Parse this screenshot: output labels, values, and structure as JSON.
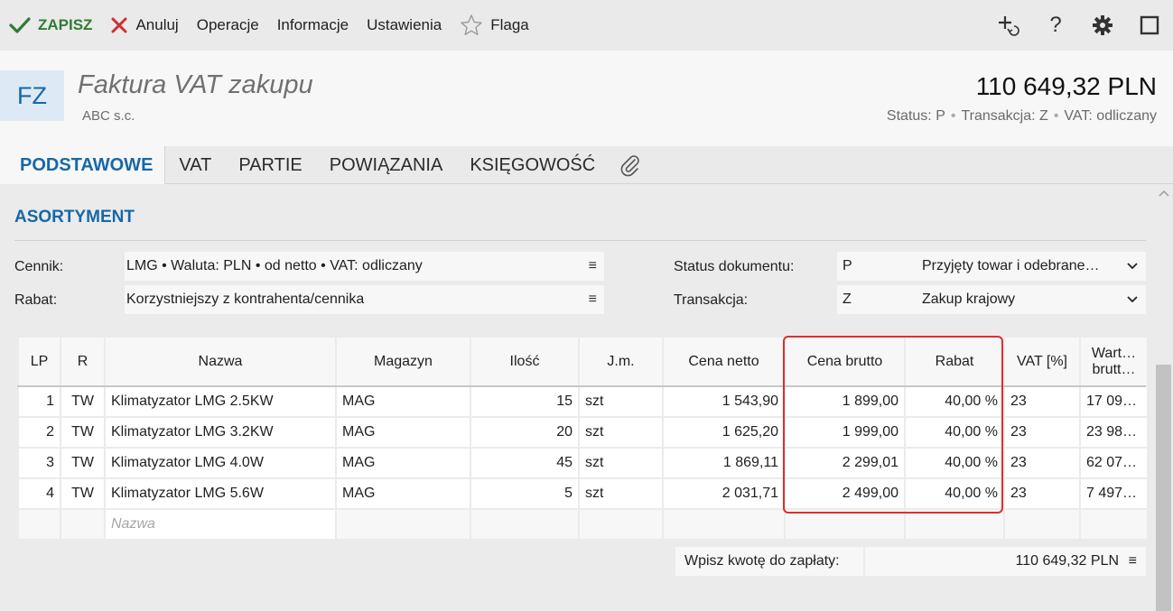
{
  "toolbar": {
    "save": "ZAPISZ",
    "cancel": "Anuluj",
    "operations": "Operacje",
    "information": "Informacje",
    "settings": "Ustawienia",
    "flag": "Flaga",
    "help": "?"
  },
  "header": {
    "badge": "FZ",
    "title": "Faktura VAT zakupu",
    "subtitle": "ABC s.c.",
    "amount": "110 649,32 PLN",
    "status_label": "Status:",
    "status_value": "P",
    "transaction_label": "Transakcja:",
    "transaction_value": "Z",
    "vat_label": "VAT:",
    "vat_value": "odliczany"
  },
  "tabs": [
    "PODSTAWOWE",
    "VAT",
    "PARTIE",
    "POWIĄZANIA",
    "KSIĘGOWOŚĆ"
  ],
  "section": {
    "title": "ASORTYMENT"
  },
  "form": {
    "pricelist_label": "Cennik:",
    "pricelist_value": "LMG • Waluta: PLN • od netto • VAT: odliczany",
    "discount_label": "Rabat:",
    "discount_value": "Korzystniejszy z kontrahenta/cennika",
    "doc_status_label": "Status dokumentu:",
    "doc_status_code": "P",
    "doc_status_value": "Przyjęty towar i odebrane…",
    "transaction_label": "Transakcja:",
    "transaction_code": "Z",
    "transaction_value": "Zakup krajowy",
    "menu_glyph": "≡"
  },
  "table": {
    "headers": {
      "lp": "LP",
      "r": "R",
      "name": "Nazwa",
      "warehouse": "Magazyn",
      "qty": "Ilość",
      "unit": "J.m.",
      "net": "Cena netto",
      "gross": "Cena brutto",
      "discount": "Rabat",
      "vat": "VAT [%]",
      "value_1": "Wart…",
      "value_2": "brutt…"
    },
    "rows": [
      {
        "lp": "1",
        "r": "TW",
        "name": "Klimatyzator LMG 2.5KW",
        "warehouse": "MAG",
        "qty": "15",
        "unit": "szt",
        "net": "1 543,90",
        "gross": "1 899,00",
        "discount": "40,00 %",
        "vat": "23",
        "value": "17 09…"
      },
      {
        "lp": "2",
        "r": "TW",
        "name": "Klimatyzator LMG 3.2KW",
        "warehouse": "MAG",
        "qty": "20",
        "unit": "szt",
        "net": "1 625,20",
        "gross": "1 999,00",
        "discount": "40,00 %",
        "vat": "23",
        "value": "23 98…"
      },
      {
        "lp": "3",
        "r": "TW",
        "name": "Klimatyzator LMG 4.0W",
        "warehouse": "MAG",
        "qty": "45",
        "unit": "szt",
        "net": "1 869,11",
        "gross": "2 299,01",
        "discount": "40,00 %",
        "vat": "23",
        "value": "62 07…"
      },
      {
        "lp": "4",
        "r": "TW",
        "name": "Klimatyzator LMG 5.6W",
        "warehouse": "MAG",
        "qty": "5",
        "unit": "szt",
        "net": "2 031,71",
        "gross": "2 499,00",
        "discount": "40,00 %",
        "vat": "23",
        "value": "7 497…"
      }
    ],
    "new_row_placeholder": "Nazwa"
  },
  "payment": {
    "label": "Wpisz kwotę do zapłaty:",
    "value": "110 649,32 PLN"
  },
  "colors": {
    "accent": "#1668a8",
    "save": "#2e7d32",
    "cancel": "#d32f2f",
    "highlight": "#e22d2d"
  }
}
